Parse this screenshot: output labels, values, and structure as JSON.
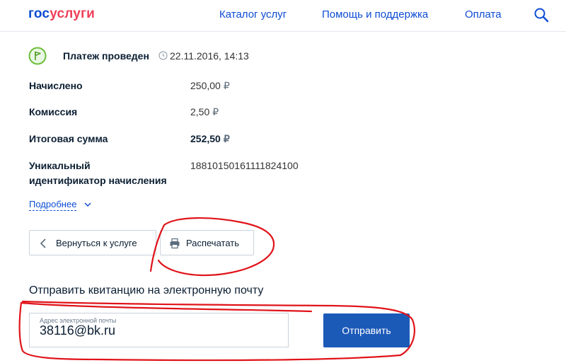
{
  "header": {
    "logo_part1": "гос",
    "logo_part2": "услуги",
    "nav": [
      "Каталог услуг",
      "Помощь и поддержка",
      "Оплата"
    ]
  },
  "status": {
    "text": "Платеж проведен",
    "datetime": "22.11.2016, 14:13"
  },
  "details": [
    {
      "label": "Начислено",
      "value": "250,00",
      "currency": "₽"
    },
    {
      "label": "Комиссия",
      "value": "2,50",
      "currency": "₽"
    },
    {
      "label": "Итоговая сумма",
      "value": "252,50",
      "currency": "₽"
    },
    {
      "label_line1": "Уникальный",
      "label_line2": "идентификатор начисления",
      "value": "18810150161111824100"
    }
  ],
  "more_link": "Подробнее",
  "buttons": {
    "back": "Вернуться к услуге",
    "print": "Распечатать"
  },
  "email_section": {
    "title": "Отправить квитанцию на электронную почту",
    "field_caption": "Адрес электронной почты",
    "field_value": "38116@bk.ru",
    "send_label": "Отправить"
  },
  "colors": {
    "brand_blue": "#0d4cd3",
    "brand_red": "#ee3f58",
    "annotation": "#e0141a"
  }
}
